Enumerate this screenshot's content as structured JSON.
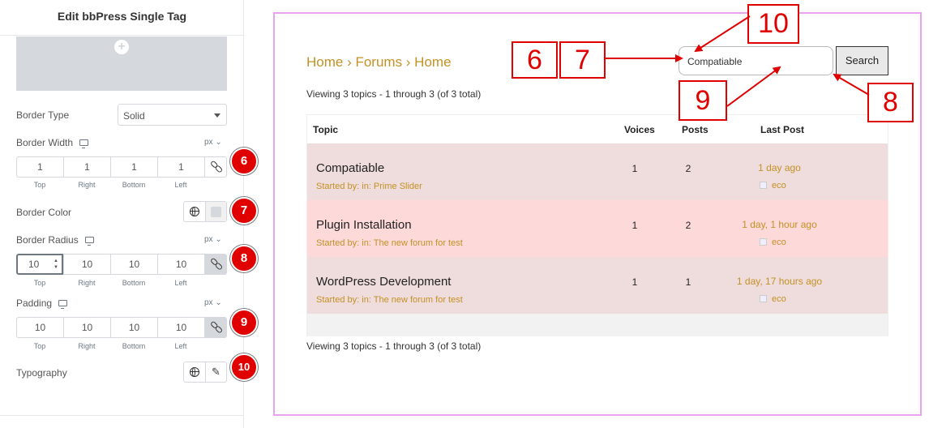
{
  "panel": {
    "title": "Edit bbPress Single Tag",
    "border_type": {
      "label": "Border Type",
      "value": "Solid"
    },
    "border_width": {
      "label": "Border Width",
      "unit": "px",
      "values": [
        "1",
        "1",
        "1",
        "1"
      ]
    },
    "border_color": {
      "label": "Border Color"
    },
    "border_radius": {
      "label": "Border Radius",
      "unit": "px",
      "values": [
        "10",
        "10",
        "10",
        "10"
      ]
    },
    "padding": {
      "label": "Padding",
      "unit": "px",
      "values": [
        "10",
        "10",
        "10",
        "10"
      ]
    },
    "typography": {
      "label": "Typography"
    },
    "dim_labels": [
      "Top",
      "Right",
      "Bottom",
      "Left"
    ],
    "badges": [
      "6",
      "7",
      "8",
      "9",
      "10"
    ]
  },
  "preview": {
    "breadcrumb": "Home › Forums › Home",
    "viewing_top": "Viewing 3 topics - 1 through 3 (of 3 total)",
    "viewing_bottom": "Viewing 3 topics - 1 through 3 (of 3 total)",
    "search": {
      "value": "Compatiable",
      "button": "Search"
    },
    "table": {
      "headers": [
        "Topic",
        "Voices",
        "Posts",
        "Last Post"
      ],
      "rows": [
        {
          "title": "Compatiable",
          "started": "Started by: in: Prime Slider",
          "voices": "1",
          "posts": "2",
          "last": "1 day ago",
          "author": "eco",
          "bg": "#efdcdc"
        },
        {
          "title": "Plugin Installation",
          "started": "Started by: in: The new forum for test",
          "voices": "1",
          "posts": "2",
          "last": "1 day, 1 hour ago",
          "author": "eco",
          "bg": "#fdd9d9"
        },
        {
          "title": "WordPress Development",
          "started": "Started by: in: The new forum for test",
          "voices": "1",
          "posts": "1",
          "last": "1 day, 17 hours ago",
          "author": "eco",
          "bg": "#efdcdc"
        }
      ]
    }
  },
  "callouts": [
    "6",
    "7",
    "10",
    "9",
    "8"
  ],
  "colors": {
    "accent_red": "#e00000",
    "link_gold": "#c39125",
    "frame_pink": "#eaa3ee"
  }
}
